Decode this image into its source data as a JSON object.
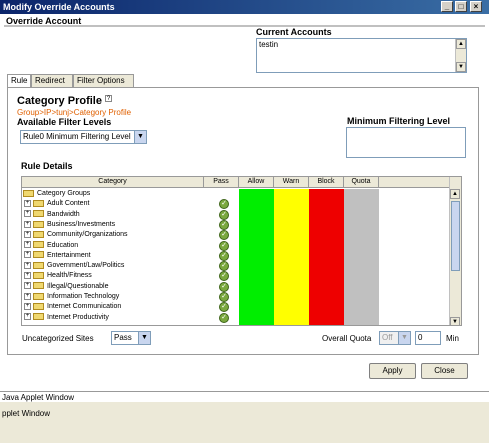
{
  "window": {
    "title": "Modify Override Accounts",
    "minimize": "_",
    "maximize": "□",
    "close": "×"
  },
  "override_account": {
    "heading": "Override Account",
    "current_accounts_label": "Current Accounts",
    "current_accounts_value": "testin"
  },
  "tabs": [
    {
      "label": "Rule",
      "active": true
    },
    {
      "label": "Redirect",
      "active": false
    },
    {
      "label": "Filter Options",
      "active": false
    }
  ],
  "rule": {
    "category_profile_label": "Category Profile",
    "breadcrumb": "Group>IP>tunj>Category Profile",
    "available_filter_levels_label": "Available Filter Levels",
    "filter_level_selected": "Rule0 Minimum Filtering Level",
    "minimum_filtering_label": "Minimum Filtering Level",
    "rule_details_label": "Rule Details"
  },
  "table": {
    "headers": [
      "Category",
      "Pass",
      "Allow",
      "Warn",
      "Block",
      "Quota"
    ],
    "group_header": "Category Groups",
    "rows": [
      "Adult Content",
      "Bandwidth",
      "Business/Investments",
      "Community/Organizations",
      "Education",
      "Entertainment",
      "Government/Law/Politics",
      "Health/Fitness",
      "Illegal/Questionable",
      "Information Technology",
      "Internet Communication",
      "Internet Productivity"
    ],
    "colors": {
      "allow": "#00ee00",
      "warn": "#ffff00",
      "block": "#ee0000",
      "quota": "#c0c0c0"
    }
  },
  "footer": {
    "uncategorized_label": "Uncategorized Sites",
    "uncategorized_value": "Pass",
    "overall_quota_label": "Overall Quota",
    "overall_quota_select": "Off",
    "quota_value": "0",
    "quota_unit": "Min",
    "apply": "Apply",
    "close": "Close"
  },
  "status": {
    "line1": "Java Applet Window",
    "line2": "pplet Window"
  }
}
